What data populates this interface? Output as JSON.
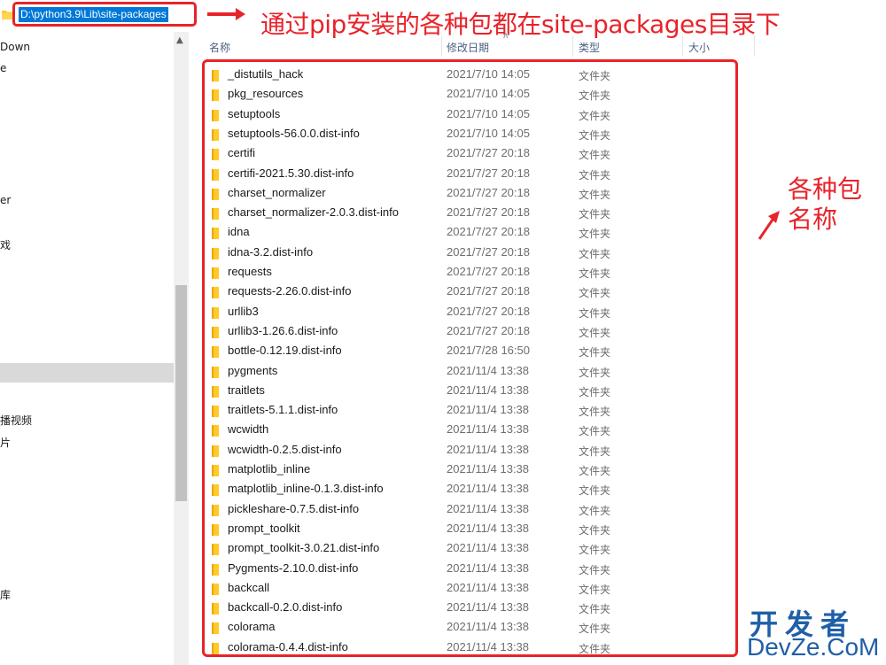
{
  "address_bar": {
    "path": "D:\\python3.9\\Lib\\site-packages"
  },
  "annotations": {
    "top": "通过pip安装的各种包都在site-packages目录下",
    "right_line1": "各种包",
    "right_line2": "名称"
  },
  "watermark": {
    "line1": "开发者",
    "line2": "DevZe.CoM"
  },
  "nav": {
    "items": [
      "Down",
      "e",
      "er",
      "戏",
      "播视频",
      "片",
      "库"
    ]
  },
  "columns": {
    "name": "名称",
    "date": "修改日期",
    "type": "类型",
    "size": "大小"
  },
  "colors": {
    "annotation_red": "#e8232a",
    "folder_yellow": "#ffca28",
    "watermark_blue": "#1f5fa8"
  },
  "files": [
    {
      "name": "_distutils_hack",
      "date": "2021/7/10 14:05",
      "type": "文件夹"
    },
    {
      "name": "pkg_resources",
      "date": "2021/7/10 14:05",
      "type": "文件夹"
    },
    {
      "name": "setuptools",
      "date": "2021/7/10 14:05",
      "type": "文件夹"
    },
    {
      "name": "setuptools-56.0.0.dist-info",
      "date": "2021/7/10 14:05",
      "type": "文件夹"
    },
    {
      "name": "certifi",
      "date": "2021/7/27 20:18",
      "type": "文件夹"
    },
    {
      "name": "certifi-2021.5.30.dist-info",
      "date": "2021/7/27 20:18",
      "type": "文件夹"
    },
    {
      "name": "charset_normalizer",
      "date": "2021/7/27 20:18",
      "type": "文件夹"
    },
    {
      "name": "charset_normalizer-2.0.3.dist-info",
      "date": "2021/7/27 20:18",
      "type": "文件夹"
    },
    {
      "name": "idna",
      "date": "2021/7/27 20:18",
      "type": "文件夹"
    },
    {
      "name": "idna-3.2.dist-info",
      "date": "2021/7/27 20:18",
      "type": "文件夹"
    },
    {
      "name": "requests",
      "date": "2021/7/27 20:18",
      "type": "文件夹"
    },
    {
      "name": "requests-2.26.0.dist-info",
      "date": "2021/7/27 20:18",
      "type": "文件夹"
    },
    {
      "name": "urllib3",
      "date": "2021/7/27 20:18",
      "type": "文件夹"
    },
    {
      "name": "urllib3-1.26.6.dist-info",
      "date": "2021/7/27 20:18",
      "type": "文件夹"
    },
    {
      "name": "bottle-0.12.19.dist-info",
      "date": "2021/7/28 16:50",
      "type": "文件夹"
    },
    {
      "name": "pygments",
      "date": "2021/11/4 13:38",
      "type": "文件夹"
    },
    {
      "name": "traitlets",
      "date": "2021/11/4 13:38",
      "type": "文件夹"
    },
    {
      "name": "traitlets-5.1.1.dist-info",
      "date": "2021/11/4 13:38",
      "type": "文件夹"
    },
    {
      "name": "wcwidth",
      "date": "2021/11/4 13:38",
      "type": "文件夹"
    },
    {
      "name": "wcwidth-0.2.5.dist-info",
      "date": "2021/11/4 13:38",
      "type": "文件夹"
    },
    {
      "name": "matplotlib_inline",
      "date": "2021/11/4 13:38",
      "type": "文件夹"
    },
    {
      "name": "matplotlib_inline-0.1.3.dist-info",
      "date": "2021/11/4 13:38",
      "type": "文件夹"
    },
    {
      "name": "pickleshare-0.7.5.dist-info",
      "date": "2021/11/4 13:38",
      "type": "文件夹"
    },
    {
      "name": "prompt_toolkit",
      "date": "2021/11/4 13:38",
      "type": "文件夹"
    },
    {
      "name": "prompt_toolkit-3.0.21.dist-info",
      "date": "2021/11/4 13:38",
      "type": "文件夹"
    },
    {
      "name": "Pygments-2.10.0.dist-info",
      "date": "2021/11/4 13:38",
      "type": "文件夹"
    },
    {
      "name": "backcall",
      "date": "2021/11/4 13:38",
      "type": "文件夹"
    },
    {
      "name": "backcall-0.2.0.dist-info",
      "date": "2021/11/4 13:38",
      "type": "文件夹"
    },
    {
      "name": "colorama",
      "date": "2021/11/4 13:38",
      "type": "文件夹"
    },
    {
      "name": "colorama-0.4.4.dist-info",
      "date": "2021/11/4 13:38",
      "type": "文件夹"
    }
  ]
}
